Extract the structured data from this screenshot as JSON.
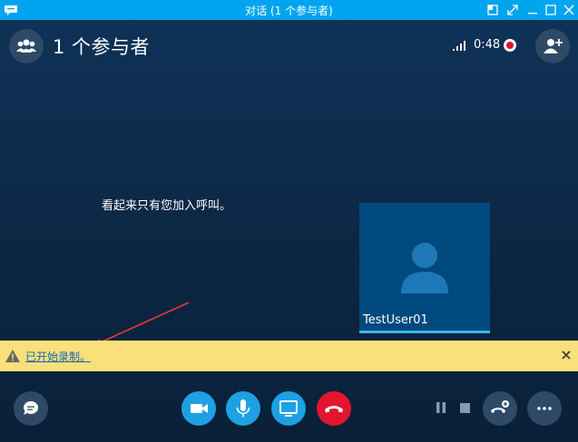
{
  "titlebar": {
    "title": "对话 (1 个参与者)"
  },
  "header": {
    "participants_label": "1 个参与者",
    "call_time": "0:48"
  },
  "main": {
    "alone_message": "看起来只有您加入呼叫。",
    "self_view": {
      "name": "TestUser01"
    }
  },
  "notification": {
    "text": "已开始录制。",
    "close_label": "×"
  },
  "colors": {
    "titlebar": "#00a4ef",
    "background": "#0e2d4d",
    "accent_blue": "#1da1e3",
    "hangup_red": "#e3152e",
    "notice_yellow": "#f9e07a",
    "record_red": "#d9142b"
  },
  "icons": {
    "app": "chat-bubble-icon",
    "people": "people-icon",
    "signal": "signal-strength-icon",
    "record": "record-icon",
    "add_person": "add-person-icon",
    "avatar": "person-avatar-icon",
    "warning": "warning-icon",
    "chat": "chat-icon",
    "video": "video-camera-icon",
    "mic": "microphone-icon",
    "share": "screen-share-icon",
    "hangup": "hang-up-icon",
    "pause": "pause-icon",
    "stop": "stop-icon",
    "dialpad": "dialpad-icon",
    "more": "more-options-icon"
  }
}
